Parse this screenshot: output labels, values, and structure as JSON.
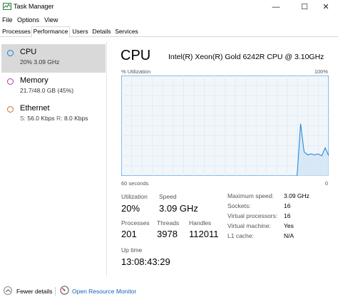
{
  "window": {
    "title": "Task Manager",
    "controls": {
      "minimize": "—",
      "maximize": "☐",
      "close": "✕"
    }
  },
  "menu": [
    "File",
    "Options",
    "View"
  ],
  "tabs": [
    "Processes",
    "Performance",
    "Users",
    "Details",
    "Services"
  ],
  "active_tab": "Performance",
  "sidebar": [
    {
      "name": "CPU",
      "sub": "20% 3.09 GHz",
      "color": "#1883d7",
      "selected": true
    },
    {
      "name": "Memory",
      "sub": "21.7/48.0 GB (45%)",
      "color": "#a33ea8",
      "selected": false
    },
    {
      "name": "Ethernet",
      "sub_s_label": "S:",
      "sub_s": "56.0 Kbps",
      "sub_r_label": "R:",
      "sub_r": "8.0 Kbps",
      "color": "#d06c2a",
      "selected": false
    }
  ],
  "main": {
    "title": "CPU",
    "model": "Intel(R) Xeon(R) Gold 6242R CPU @ 3.10GHz",
    "util_label": "% Utilization",
    "util_max": "100%",
    "axis_left": "60 seconds",
    "axis_right": "0",
    "graph_color": "#1883d7",
    "graph_fill": "#f1f6fb",
    "utilization_history": [
      0,
      0,
      0,
      0,
      0,
      0,
      0,
      0,
      0,
      0,
      0,
      0,
      0,
      0,
      0,
      0,
      0,
      0,
      0,
      0,
      0,
      0,
      0,
      0,
      0,
      0,
      0,
      0,
      0,
      0,
      0,
      0,
      0,
      0,
      0,
      0,
      0,
      0,
      0,
      0,
      0,
      0,
      0,
      0,
      0,
      0,
      0,
      0,
      0,
      0,
      0,
      52,
      24,
      21,
      22,
      21,
      22,
      20,
      28,
      20
    ],
    "stats": {
      "utilization_label": "Utilization",
      "utilization": "20%",
      "speed_label": "Speed",
      "speed": "3.09 GHz",
      "processes_label": "Processes",
      "processes": "201",
      "threads_label": "Threads",
      "threads": "3978",
      "handles_label": "Handles",
      "handles": "112011",
      "uptime_label": "Up time",
      "uptime": "13:08:43:29"
    },
    "details": [
      {
        "label": "Maximum speed:",
        "value": "3.09 GHz"
      },
      {
        "label": "Sockets:",
        "value": "16"
      },
      {
        "label": "Virtual processors:",
        "value": "16"
      },
      {
        "label": "Virtual machine:",
        "value": "Yes"
      },
      {
        "label": "L1 cache:",
        "value": "N/A"
      }
    ]
  },
  "footer": {
    "fewer_details": "Fewer details",
    "open_monitor": "Open Resource Monitor"
  }
}
